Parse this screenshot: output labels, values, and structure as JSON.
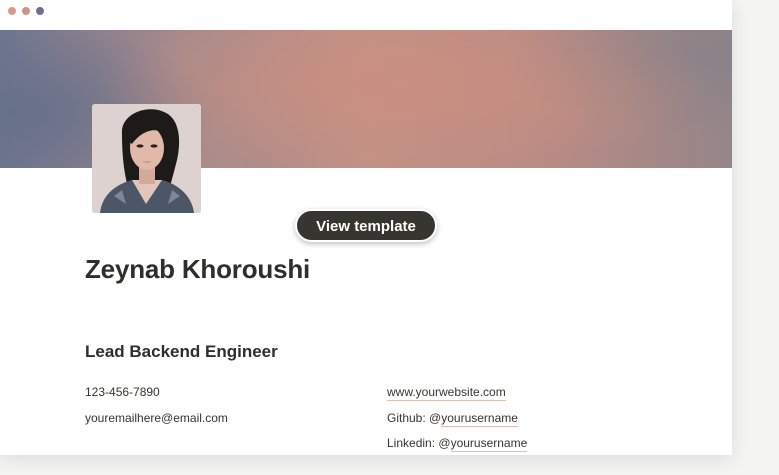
{
  "window": {
    "colors": [
      "#d99a8a",
      "#c8948e",
      "#6d7191"
    ]
  },
  "hero": {
    "view_template_label": "View template"
  },
  "profile": {
    "name": "Zeynab Khoroushi",
    "role": "Lead Backend Engineer"
  },
  "contact": {
    "phone": "123-456-7890",
    "email": "youremailhere@email.com",
    "website": "www.yourwebsite.com",
    "github_prefix": "Github: @",
    "github_handle": "yourusername",
    "linkedin_prefix": "Linkedin: @",
    "linkedin_handle": "yourusername"
  }
}
